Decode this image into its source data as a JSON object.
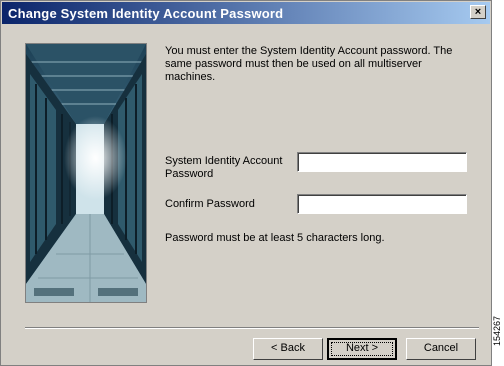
{
  "window": {
    "title": "Change System Identity Account Password",
    "close_label": "×"
  },
  "content": {
    "message": "You must enter the System Identity Account password. The same password must then be used on all multiserver machines.",
    "system_identity_label": "System Identity Account Password",
    "system_identity_value": "",
    "confirm_label": "Confirm Password",
    "confirm_value": "",
    "note": "Password must be at least 5 characters long."
  },
  "buttons": {
    "back": "< Back",
    "next": "Next >",
    "cancel": "Cancel"
  },
  "figure_id": "154267",
  "colors": {
    "title_gradient_start": "#0a246a",
    "title_gradient_end": "#a6caf0",
    "dialog_bg": "#d4d0c8"
  }
}
